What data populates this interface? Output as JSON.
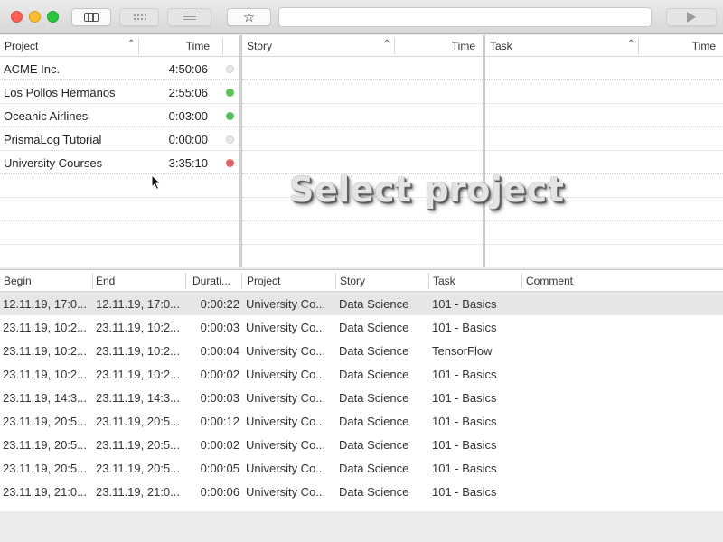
{
  "toolbar": {
    "view_buttons": [
      "columns-icon",
      "grid-icon",
      "list-icon"
    ],
    "favorite_icon": "star-icon",
    "search_placeholder": "",
    "run_icon": "play-icon"
  },
  "panes": {
    "project": {
      "header_name": "Project",
      "header_time": "Time",
      "items": [
        {
          "name": "ACME Inc.",
          "time": "4:50:06",
          "status_color": "#e8e8e8"
        },
        {
          "name": "Los Pollos Hermanos",
          "time": "2:55:06",
          "status_color": "#5cc15a"
        },
        {
          "name": "Oceanic Airlines",
          "time": "0:03:00",
          "status_color": "#5cc15a"
        },
        {
          "name": "PrismaLog Tutorial",
          "time": "0:00:00",
          "status_color": "#e8e8e8"
        },
        {
          "name": "University Courses",
          "time": "3:35:10",
          "status_color": "#e26361"
        }
      ]
    },
    "story": {
      "header_name": "Story",
      "header_time": "Time"
    },
    "task": {
      "header_name": "Task",
      "header_time": "Time"
    },
    "overlay_text": "Select project"
  },
  "log": {
    "columns": [
      "Begin",
      "End",
      "Durati...",
      "Project",
      "Story",
      "Task",
      "Comment"
    ],
    "rows": [
      {
        "begin": "12.11.19, 17:0...",
        "end": "12.11.19, 17:0...",
        "duration": "0:00:22",
        "project": "University Co...",
        "story": "Data Science",
        "task": "101 - Basics",
        "comment": ""
      },
      {
        "begin": "23.11.19, 10:2...",
        "end": "23.11.19, 10:2...",
        "duration": "0:00:03",
        "project": "University Co...",
        "story": "Data Science",
        "task": "101 - Basics",
        "comment": ""
      },
      {
        "begin": "23.11.19, 10:2...",
        "end": "23.11.19, 10:2...",
        "duration": "0:00:04",
        "project": "University Co...",
        "story": "Data Science",
        "task": "TensorFlow",
        "comment": ""
      },
      {
        "begin": "23.11.19, 10:2...",
        "end": "23.11.19, 10:2...",
        "duration": "0:00:02",
        "project": "University Co...",
        "story": "Data Science",
        "task": "101 - Basics",
        "comment": ""
      },
      {
        "begin": "23.11.19, 14:3...",
        "end": "23.11.19, 14:3...",
        "duration": "0:00:03",
        "project": "University Co...",
        "story": "Data Science",
        "task": "101 - Basics",
        "comment": ""
      },
      {
        "begin": "23.11.19, 20:5...",
        "end": "23.11.19, 20:5...",
        "duration": "0:00:12",
        "project": "University Co...",
        "story": "Data Science",
        "task": "101 - Basics",
        "comment": ""
      },
      {
        "begin": "23.11.19, 20:5...",
        "end": "23.11.19, 20:5...",
        "duration": "0:00:02",
        "project": "University Co...",
        "story": "Data Science",
        "task": "101 - Basics",
        "comment": ""
      },
      {
        "begin": "23.11.19, 20:5...",
        "end": "23.11.19, 20:5...",
        "duration": "0:00:05",
        "project": "University Co...",
        "story": "Data Science",
        "task": "101 - Basics",
        "comment": ""
      },
      {
        "begin": "23.11.19, 21:0...",
        "end": "23.11.19, 21:0...",
        "duration": "0:00:06",
        "project": "University Co...",
        "story": "Data Science",
        "task": "101 - Basics",
        "comment": ""
      }
    ]
  },
  "colors": {
    "selected_row": "#e6e6e6",
    "status_green": "#5cc15a",
    "status_red": "#e26361",
    "status_inactive": "#e8e8e8"
  }
}
